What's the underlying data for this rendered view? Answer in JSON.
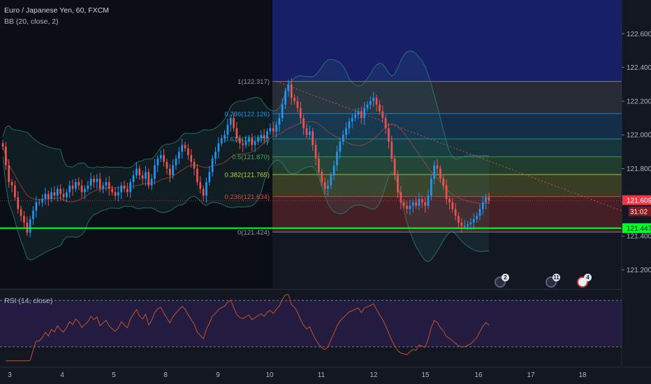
{
  "header": {
    "symbol": "Euro / Japanese Yen, 60, FXCM",
    "indicator": "BB (20, close, 2)"
  },
  "rsi_label": "RSI (14, close)",
  "colors": {
    "background": "#131722",
    "up_candle": "#2196f3",
    "down_candle": "#ef5350",
    "support_line": "#00ff2a",
    "price_tag": "#f23645",
    "bollinger": "#2f8f8a",
    "rsi_line": "#c0532b",
    "rsi_band": "#2b1f4b"
  },
  "badges": [
    {
      "label": "2",
      "style": "blue"
    },
    {
      "label": "11",
      "style": "blue"
    },
    {
      "label": "4",
      "style": "red"
    }
  ],
  "chart_data": {
    "type": "candlestick",
    "x_ticks": [
      "3",
      "4",
      "5",
      "8",
      "9",
      "10",
      "11",
      "12",
      "15",
      "16",
      "17",
      "18"
    ],
    "y_ticks": [
      "122.600",
      "122.400",
      "122.200",
      "122.000",
      "121.800",
      "121.600",
      "121.400",
      "121.200"
    ],
    "price_range": [
      121.09,
      122.8
    ],
    "support_price": 121.447,
    "support_label": "121.447",
    "last_price": 121.609,
    "last_price_label": "121.609",
    "countdown_label": "31:02",
    "fibonacci": {
      "high": 122.317,
      "low": 121.424,
      "levels": [
        {
          "label": "1(122.317)",
          "price": 122.317,
          "color": "#9598a1",
          "fill": "rgba(120,123,134,0.22)"
        },
        {
          "label": "0.786(122.126)",
          "price": 122.126,
          "color": "#2196f3",
          "fill": "rgba(33,150,243,0.18)"
        },
        {
          "label": "0.618(121.976)",
          "price": 121.976,
          "color": "#26a69a",
          "fill": "rgba(38,166,154,0.22)"
        },
        {
          "label": "0.5(121.870)",
          "price": 121.87,
          "color": "#4caf50",
          "fill": "rgba(76,175,80,0.25)"
        },
        {
          "label": "0.382(121.765)",
          "price": 121.765,
          "color": "#cddc39",
          "fill": "rgba(205,220,57,0.20)"
        },
        {
          "label": "0.236(121.634)",
          "price": 121.634,
          "color": "#f44336",
          "fill": "rgba(244,67,54,0.22)"
        },
        {
          "label": "0(121.424)",
          "price": 121.424,
          "color": "#9598a1",
          "fill": null
        }
      ]
    },
    "close_series": [
      121.93,
      121.82,
      121.72,
      121.7,
      121.63,
      121.56,
      121.52,
      121.48,
      121.42,
      121.5,
      121.55,
      121.6,
      121.6,
      121.62,
      121.65,
      121.62,
      121.66,
      121.64,
      121.68,
      121.65,
      121.63,
      121.66,
      121.7,
      121.68,
      121.72,
      121.7,
      121.66,
      121.68,
      121.7,
      121.74,
      121.72,
      121.74,
      121.68,
      121.7,
      121.72,
      121.68,
      121.66,
      121.64,
      121.66,
      121.7,
      121.68,
      121.66,
      121.72,
      121.76,
      121.8,
      121.76,
      121.74,
      121.78,
      121.7,
      121.74,
      121.82,
      121.86,
      121.88,
      121.84,
      121.8,
      121.76,
      121.82,
      121.86,
      121.9,
      121.94,
      121.92,
      121.88,
      121.84,
      121.8,
      121.72,
      121.68,
      121.64,
      121.72,
      121.78,
      121.86,
      121.9,
      121.95,
      121.98,
      122.0,
      122.06,
      122.1,
      122.04,
      121.98,
      121.95,
      121.94,
      121.96,
      121.98,
      121.94,
      121.96,
      121.98,
      122.0,
      121.98,
      122.02,
      122.04,
      122.02,
      122.06,
      122.1,
      122.18,
      122.26,
      122.3,
      122.22,
      122.2,
      122.16,
      122.1,
      122.04,
      122.0,
      122.02,
      121.94,
      121.86,
      121.78,
      121.72,
      121.68,
      121.7,
      121.76,
      121.82,
      121.9,
      121.96,
      122.0,
      122.04,
      122.08,
      122.1,
      122.12,
      122.14,
      122.1,
      122.16,
      122.18,
      122.2,
      122.22,
      122.18,
      122.14,
      122.1,
      122.04,
      121.96,
      121.86,
      121.76,
      121.66,
      121.6,
      121.58,
      121.56,
      121.58,
      121.6,
      121.58,
      121.62,
      121.6,
      121.58,
      121.64,
      121.74,
      121.82,
      121.8,
      121.74,
      121.7,
      121.62,
      121.6,
      121.56,
      121.52,
      121.48,
      121.46,
      121.46,
      121.47,
      121.48,
      121.5,
      121.52,
      121.56,
      121.6,
      121.63,
      121.61
    ]
  }
}
